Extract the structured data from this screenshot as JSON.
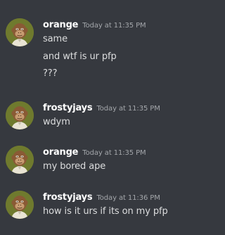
{
  "messages": [
    {
      "author": "orange",
      "timestamp": "Today at 11:35 PM",
      "lines": [
        "same",
        "and wtf is ur pfp",
        "???"
      ]
    },
    {
      "author": "frostyjays",
      "timestamp": "Today at 11:35 PM",
      "lines": [
        "wdym"
      ]
    },
    {
      "author": "orange",
      "timestamp": "Today at 11:35 PM",
      "lines": [
        "my bored ape"
      ]
    },
    {
      "author": "frostyjays",
      "timestamp": "Today at 11:36 PM",
      "lines": [
        "how is it urs if its on my pfp"
      ]
    }
  ],
  "colors": {
    "background": "#36393f",
    "username": "#ffffff",
    "timestamp": "#a3a6aa",
    "text": "#dcddde",
    "avatar_bg": "#6f7a2e"
  },
  "icons": {
    "avatar": "bored-ape-avatar-icon"
  }
}
